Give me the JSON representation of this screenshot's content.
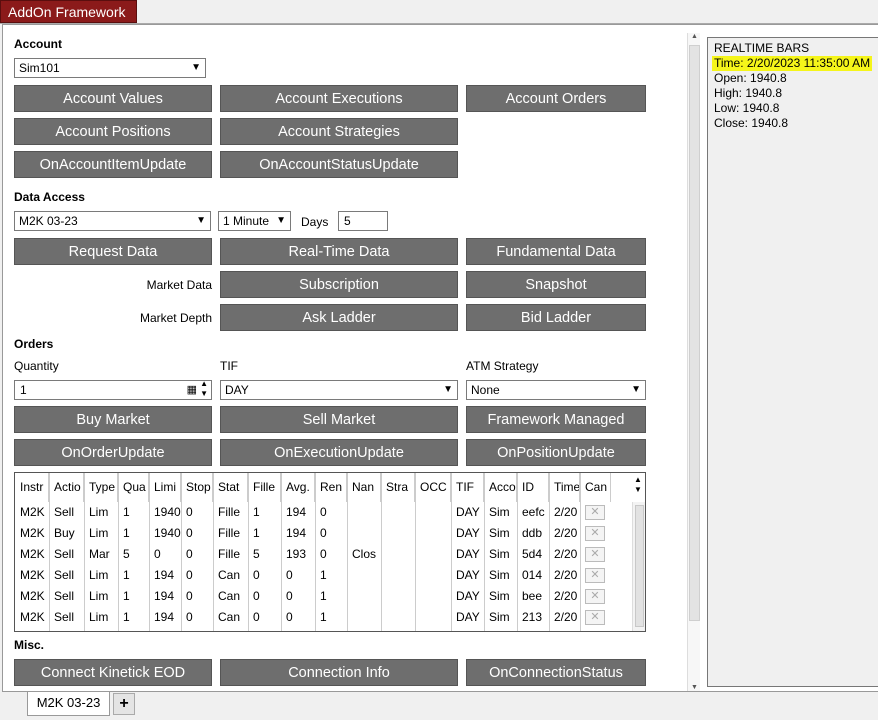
{
  "window": {
    "title": "AddOn Framework"
  },
  "account": {
    "section_title": "Account",
    "selected_account": "Sim101",
    "buttons": {
      "values": "Account Values",
      "executions": "Account Executions",
      "orders": "Account Orders",
      "positions": "Account Positions",
      "strategies": "Account Strategies",
      "item_update": "OnAccountItemUpdate",
      "status_update": "OnAccountStatusUpdate"
    }
  },
  "data_access": {
    "section_title": "Data Access",
    "instrument": "M2K 03-23",
    "interval": "1 Minute",
    "days_label": "Days",
    "days_value": "5",
    "buttons": {
      "request": "Request Data",
      "realtime": "Real-Time Data",
      "fundamental": "Fundamental Data",
      "subscription": "Subscription",
      "snapshot": "Snapshot",
      "ask_ladder": "Ask Ladder",
      "bid_ladder": "Bid Ladder"
    },
    "market_data_label": "Market Data",
    "market_depth_label": "Market Depth"
  },
  "orders": {
    "section_title": "Orders",
    "quantity_label": "Quantity",
    "quantity_value": "1",
    "tif_label": "TIF",
    "tif_value": "DAY",
    "atm_label": "ATM Strategy",
    "atm_value": "None",
    "buttons": {
      "buy_market": "Buy Market",
      "sell_market": "Sell Market",
      "framework_managed": "Framework Managed",
      "order_update": "OnOrderUpdate",
      "execution_update": "OnExecutionUpdate",
      "position_update": "OnPositionUpdate"
    },
    "grid": {
      "columns": [
        "Instr",
        "Actio",
        "Type",
        "Qua",
        "Limi",
        "Stop",
        "Stat",
        "Fille",
        "Avg.",
        "Ren",
        "Nan",
        "Stra",
        "OCC",
        "TIF",
        "Acco",
        "ID",
        "Time",
        "Can"
      ],
      "rows": [
        [
          "M2K",
          "Sell",
          "Lim",
          "1",
          "1940",
          "0",
          "Fille",
          "1",
          "194",
          "0",
          "",
          "",
          "",
          "DAY",
          "Sim",
          "eefc",
          "2/20"
        ],
        [
          "M2K",
          "Buy",
          "Lim",
          "1",
          "1940",
          "0",
          "Fille",
          "1",
          "194",
          "0",
          "",
          "",
          "",
          "DAY",
          "Sim",
          "ddb",
          "2/20"
        ],
        [
          "M2K",
          "Sell",
          "Mar",
          "5",
          "0",
          "0",
          "Fille",
          "5",
          "193",
          "0",
          "Clos",
          "",
          "",
          "DAY",
          "Sim",
          "5d4",
          "2/20"
        ],
        [
          "M2K",
          "Sell",
          "Lim",
          "1",
          "194",
          "0",
          "Can",
          "0",
          "0",
          "1",
          "",
          "",
          "",
          "DAY",
          "Sim",
          "014",
          "2/20"
        ],
        [
          "M2K",
          "Sell",
          "Lim",
          "1",
          "194",
          "0",
          "Can",
          "0",
          "0",
          "1",
          "",
          "",
          "",
          "DAY",
          "Sim",
          "bee",
          "2/20"
        ],
        [
          "M2K",
          "Sell",
          "Lim",
          "1",
          "194",
          "0",
          "Can",
          "0",
          "0",
          "1",
          "",
          "",
          "",
          "DAY",
          "Sim",
          "213",
          "2/20"
        ]
      ],
      "cancel_glyph": "✕"
    }
  },
  "misc": {
    "section_title": "Misc.",
    "buttons": {
      "kinetick": "Connect Kinetick EOD",
      "connection_info": "Connection Info",
      "connection_status": "OnConnectionStatus"
    }
  },
  "output": {
    "lines": [
      "REALTIME BARS",
      "Time: 2/20/2023 11:35:00 AM",
      "Open: 1940.8",
      "High: 1940.8",
      "Low: 1940.8",
      "Close: 1940.8"
    ],
    "highlight_color": "#f5f51a"
  },
  "tabs": {
    "active": "M2K 03-23",
    "add_glyph": "+"
  },
  "colors": {
    "title_bar": "#8b1a1a",
    "button": "#6e6e6e"
  }
}
